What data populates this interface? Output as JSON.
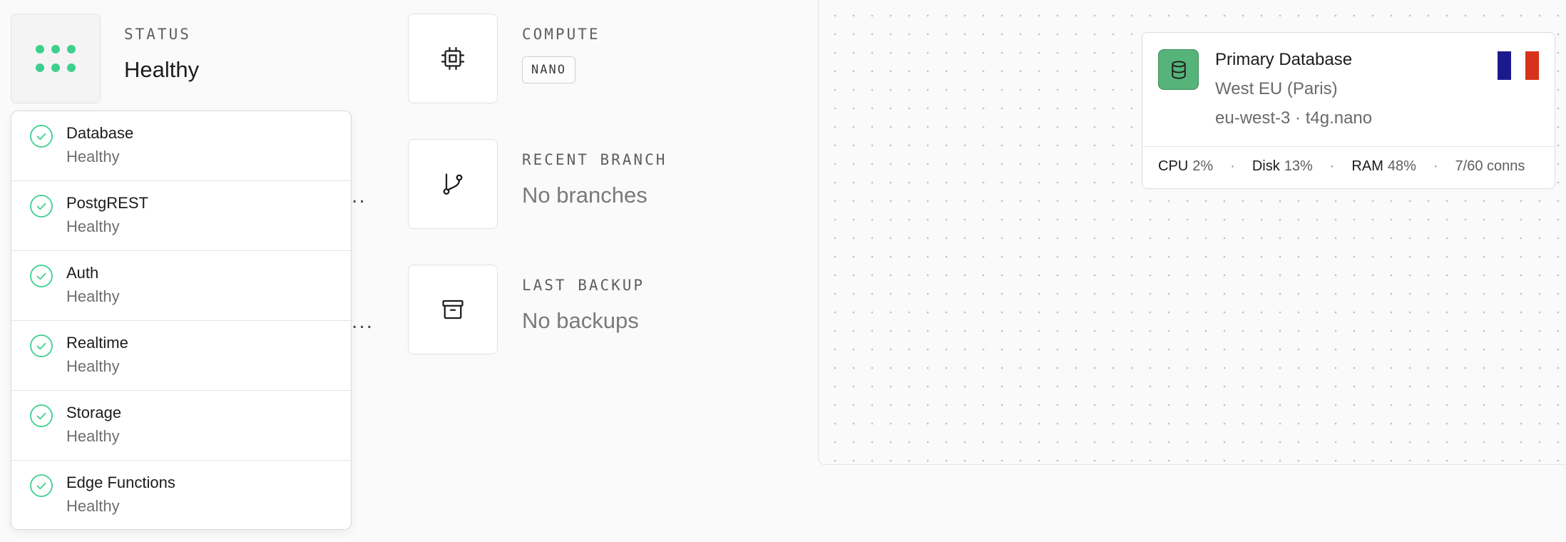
{
  "status": {
    "label": "STATUS",
    "value": "Healthy",
    "services": [
      {
        "name": "Database",
        "status": "Healthy"
      },
      {
        "name": "PostgREST",
        "status": "Healthy"
      },
      {
        "name": "Auth",
        "status": "Healthy"
      },
      {
        "name": "Realtime",
        "status": "Healthy"
      },
      {
        "name": "Storage",
        "status": "Healthy"
      },
      {
        "name": "Edge Functions",
        "status": "Healthy"
      }
    ]
  },
  "compute": {
    "label": "COMPUTE",
    "size": "NANO"
  },
  "recent_branch": {
    "label": "RECENT BRANCH",
    "value": "No branches"
  },
  "last_backup": {
    "label": "LAST BACKUP",
    "value": "No backups"
  },
  "overflow": {
    "row2": "..",
    "row3": "..."
  },
  "database_card": {
    "title": "Primary Database",
    "region": "West EU (Paris)",
    "zone": "eu-west-3 · t4g.nano",
    "stats": {
      "cpu_label": "CPU",
      "cpu": "2%",
      "disk_label": "Disk",
      "disk": "13%",
      "ram_label": "RAM",
      "ram": "48%",
      "conns": "7/60 conns",
      "separator": "·"
    }
  },
  "colors": {
    "healthy": "#3ecf8e",
    "brand_green": "#56b37a",
    "flag_blue": "#1b1a8c",
    "flag_white": "#ffffff",
    "flag_red": "#d7321b"
  }
}
